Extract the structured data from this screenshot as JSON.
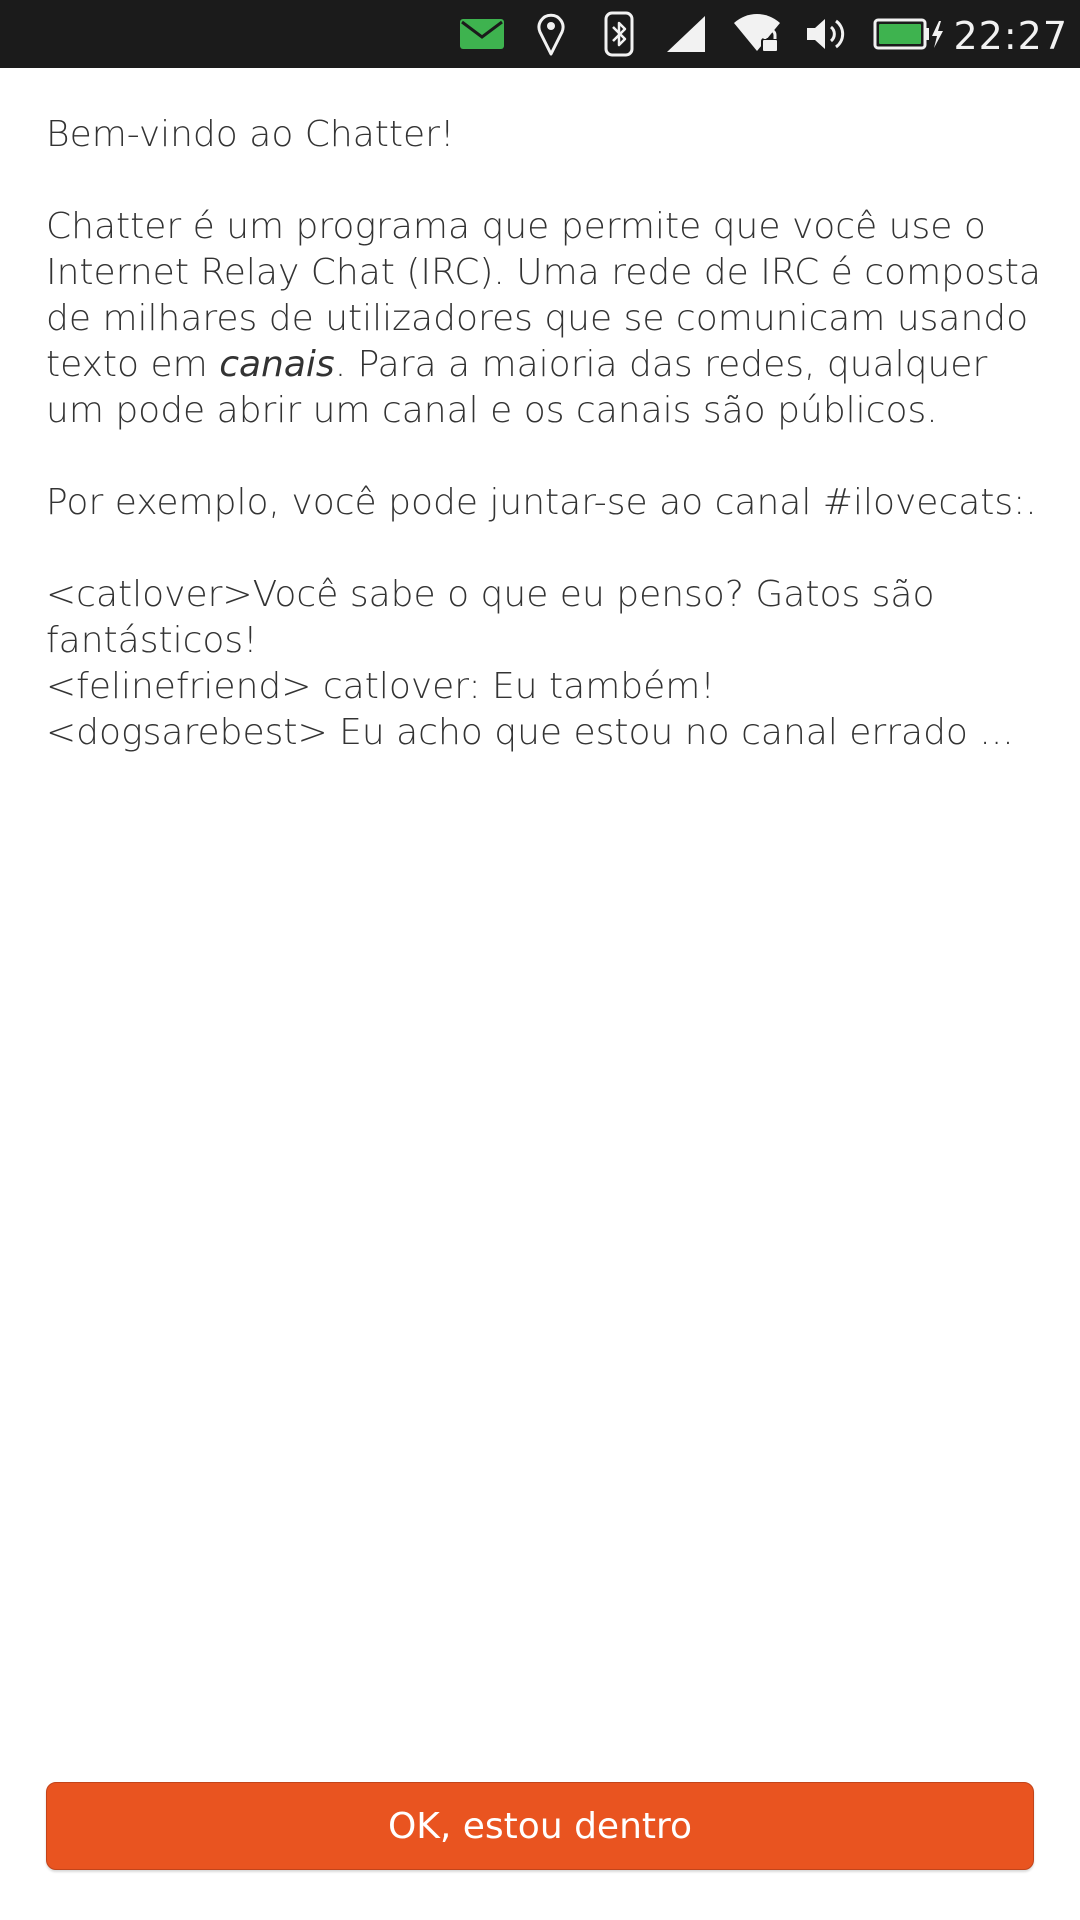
{
  "status_bar": {
    "time": "22:27",
    "icons": [
      "mail-icon",
      "location-icon",
      "bluetooth-icon",
      "cellular-signal-icon",
      "wifi-locked-icon",
      "volume-icon",
      "battery-charging-icon"
    ],
    "colors": {
      "background": "#1b1b1b",
      "mail_accent": "#3eb34f",
      "battery_fill": "#3eb34f"
    }
  },
  "welcome": {
    "title": "Bem-vindo ao Chatter!",
    "intro_part1": "Chatter é um programa que permite que você use o Internet Relay Chat (IRC). Uma rede de IRC é composta de milhares de utilizadores que se comunicam usando texto em ",
    "intro_emphasis": "canais",
    "intro_part2": ". Para a maioria das redes, qualquer um pode abrir um canal e os canais são públicos.",
    "example_intro": "Por exemplo, você pode juntar-se ao canal #ilovecats:.",
    "chat_lines": [
      "<catlover>Você sabe o que eu penso? Gatos são fantásticos!",
      "<felinefriend> catlover: Eu também!",
      "<dogsarebest> Eu acho que estou no canal errado ..."
    ]
  },
  "ok_button": {
    "label": "OK, estou dentro",
    "color": "#e95420"
  }
}
